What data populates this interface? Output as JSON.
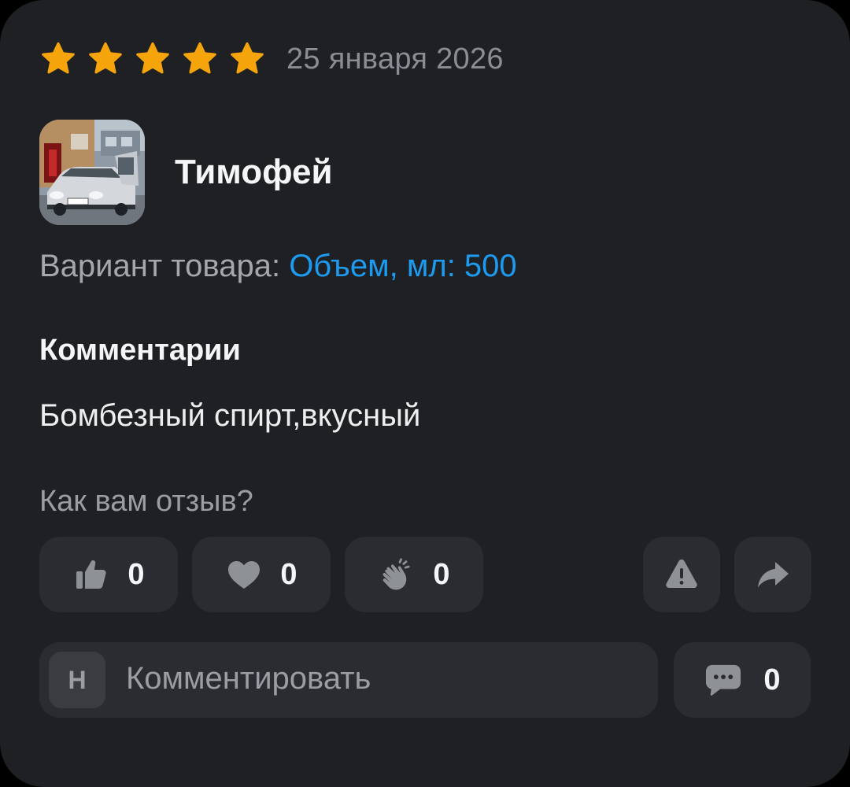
{
  "review": {
    "rating": 5,
    "rating_max": 5,
    "date": "25 января 2026",
    "author": {
      "name": "Тимофей",
      "avatar_icon": "car-photo"
    },
    "variant": {
      "label": "Вариант товара:",
      "value": "Объем, мл: 500"
    },
    "comments_heading": "Комментарии",
    "comment_text": "Бомбезный спирт,вкусный"
  },
  "feedback": {
    "question": "Как вам отзыв?",
    "reactions": [
      {
        "icon": "thumbs-up-icon",
        "count": "0"
      },
      {
        "icon": "heart-icon",
        "count": "0"
      },
      {
        "icon": "clapping-hands-icon",
        "count": "0"
      }
    ],
    "actions": [
      {
        "icon": "report-warning-icon"
      },
      {
        "icon": "share-arrow-icon"
      }
    ]
  },
  "composer": {
    "user_initial": "Н",
    "placeholder": "Комментировать",
    "comments_count": "0"
  },
  "colors": {
    "card_bg": "#1e2024",
    "button_bg": "#2a2c31",
    "star": "#f5a50b",
    "accent_link": "#1d9bf0",
    "icon_gray": "#8e9196"
  }
}
